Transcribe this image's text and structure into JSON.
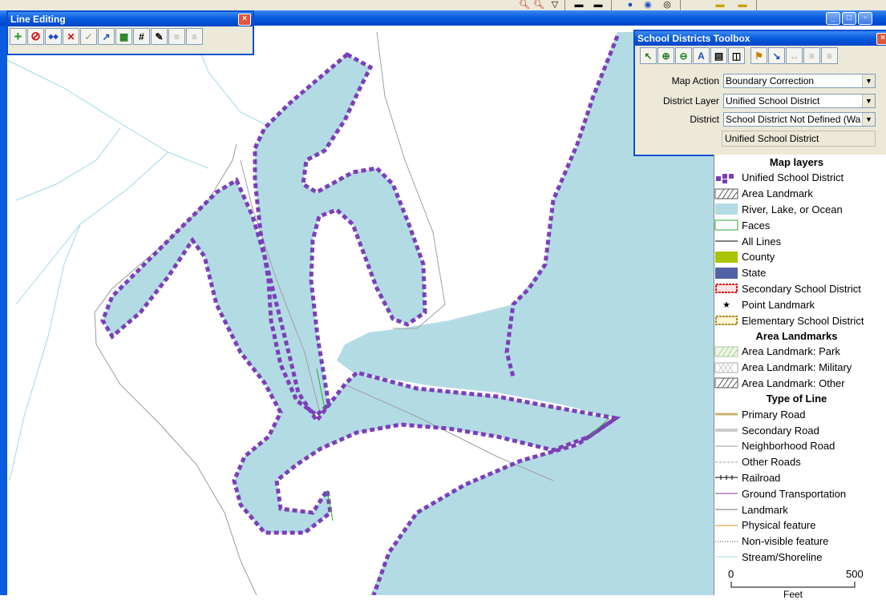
{
  "line_editing": {
    "title": "Line Editing",
    "close": "×",
    "tools": [
      {
        "glyph": "+",
        "icon": "add-line-icon"
      },
      {
        "glyph": "⊘",
        "icon": "delete-icon"
      },
      {
        "glyph": "◆◆",
        "icon": "split-line-icon"
      },
      {
        "glyph": "✕",
        "icon": "remove-node-icon"
      },
      {
        "glyph": "✓",
        "icon": "validate-icon"
      },
      {
        "glyph": "↗",
        "icon": "line-info-icon"
      },
      {
        "glyph": "▦",
        "icon": "attribute-table-icon"
      },
      {
        "glyph": "#",
        "icon": "numbering-icon"
      },
      {
        "glyph": "✎",
        "icon": "edit-vertex-icon"
      },
      {
        "glyph": "≡",
        "icon": "more-tools-icon"
      },
      {
        "glyph": "≡",
        "icon": "more-tools-2-icon"
      }
    ]
  },
  "toolbox": {
    "title": "School Districts Toolbox",
    "close": "×",
    "tools": [
      {
        "glyph": "↖",
        "icon": "select-icon"
      },
      {
        "glyph": "⊕",
        "icon": "zoom-in-icon"
      },
      {
        "glyph": "⊖",
        "icon": "zoom-out-icon"
      },
      {
        "glyph": "A",
        "icon": "label-icon"
      },
      {
        "glyph": "▤",
        "icon": "report-icon"
      },
      {
        "glyph": "◫",
        "icon": "page-icon"
      },
      {
        "glyph": "⚑",
        "icon": "flag-icon"
      },
      {
        "glyph": "↘",
        "icon": "pointer-icon"
      },
      {
        "glyph": "↔",
        "icon": "merge-icon"
      },
      {
        "glyph": "≡",
        "icon": "more-tools-icon"
      },
      {
        "glyph": "≡",
        "icon": "more-tools-2-icon"
      }
    ],
    "map_action_label": "Map Action",
    "map_action_value": "Boundary Correction",
    "district_layer_label": "District Layer",
    "district_layer_value": "Unified School District",
    "district_label": "District",
    "district_value": "School District Not Defined (Wa",
    "status_value": "Unified School District"
  },
  "legend": {
    "heading_layers": "Map layers",
    "heading_area": "Area Landmarks",
    "heading_type": "Type of Line",
    "items": [
      "Unified School District",
      "Area Landmark",
      "River, Lake, or Ocean",
      "Faces",
      "All Lines",
      "County",
      "State",
      "Secondary School District",
      "Point Landmark",
      "Elementary School District"
    ],
    "area_items": [
      "Area Landmark: Park",
      "Area Landmark: Military",
      "Area Landmark: Other"
    ],
    "line_items": [
      "Primary Road",
      "Secondary Road",
      "Neighborhood Road",
      "Other Roads",
      "Railroad",
      "Ground Transportation",
      "Landmark",
      "Physical feature",
      "Non-visible feature",
      "Stream/Shoreline"
    ],
    "scale_start": "0",
    "scale_end": "500",
    "scale_unit": "Feet"
  },
  "colors": {
    "water": "#b3dbe4",
    "district_boundary": "#7b3fb8",
    "title_bar": "#0a5de0",
    "county": "#a9c400",
    "state": "#5262a6",
    "stream": "#9fd8ec"
  }
}
